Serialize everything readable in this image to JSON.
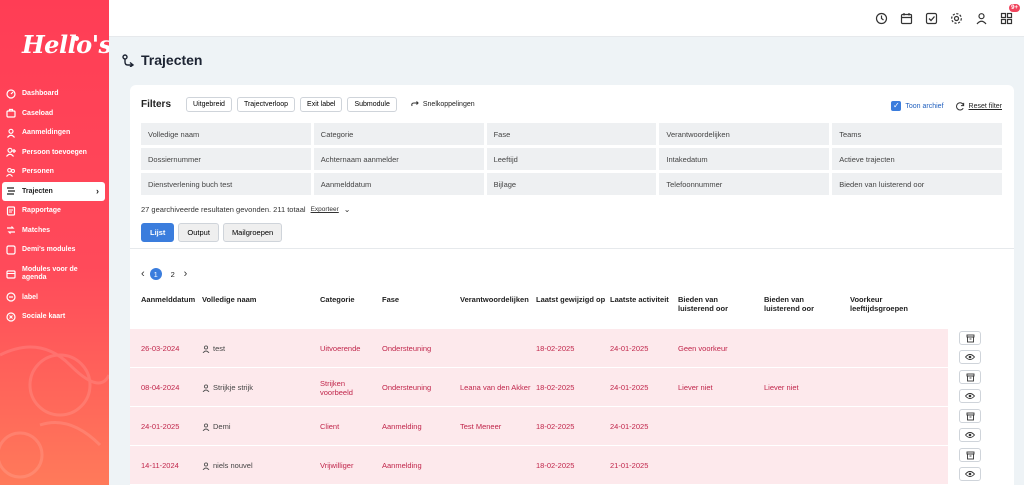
{
  "brand": {
    "logo": "Hello's",
    "accent": "#ff4a5a",
    "primary": "#3b7ddd",
    "row_tint": "#fde9ec"
  },
  "sidebar": {
    "items": [
      {
        "label": "Dashboard",
        "icon": "dashboard-icon"
      },
      {
        "label": "Caseload",
        "icon": "briefcase-icon"
      },
      {
        "label": "Aanmeldingen",
        "icon": "user-icon"
      },
      {
        "label": "Persoon toevoegen",
        "icon": "user-plus-icon"
      },
      {
        "label": "Personen",
        "icon": "users-icon"
      },
      {
        "label": "Trajecten",
        "icon": "route-icon",
        "active": true
      },
      {
        "label": "Rapportage",
        "icon": "report-icon"
      },
      {
        "label": "Matches",
        "icon": "match-icon"
      },
      {
        "label": "Demi's modules",
        "icon": "module-icon"
      },
      {
        "label": "Modules voor de agenda",
        "icon": "calendar-module-icon"
      },
      {
        "label": "label",
        "icon": "label-icon"
      },
      {
        "label": "Sociale kaart",
        "icon": "map-icon"
      }
    ]
  },
  "topbar": {
    "notification_badge": "9+"
  },
  "page": {
    "title": "Trajecten"
  },
  "filters": {
    "title": "Filters",
    "chips": [
      "Uitgebreid",
      "Trajectverloop",
      "Exit label",
      "Submodule"
    ],
    "shortcuts_label": "Snelkoppelingen",
    "show_archive_label": "Toon archief",
    "reset_label": "Reset filter",
    "fields": [
      "Volledige naam",
      "Categorie",
      "Fase",
      "Verantwoordelijken",
      "Teams",
      "Dossiernummer",
      "Achternaam aanmelder",
      "Leeftijd",
      "Intakedatum",
      "Actieve trajecten",
      "Dienstverlening buch test",
      "Aanmelddatum",
      "Bijlage",
      "Telefoonnummer",
      "Bieden van luisterend oor"
    ]
  },
  "results": {
    "summary": "27 gearchiveerde resultaten gevonden. 211 totaal",
    "export_label": "Exporteer"
  },
  "view_tabs": [
    "Lijst",
    "Output",
    "Mailgroepen"
  ],
  "pagination": {
    "pages": [
      "1",
      "2"
    ],
    "current": "1"
  },
  "table": {
    "columns": [
      "Aanmelddatum",
      "Volledige naam",
      "Categorie",
      "Fase",
      "Verantwoordelijken",
      "Laatst gewijzigd op",
      "Laatste activiteit",
      "Bieden van luisterend oor",
      "Bieden van luisterend oor",
      "Voorkeur leeftijdsgroepen"
    ],
    "rows": [
      {
        "date": "26-03-2024",
        "name": "test",
        "category": "Uitvoerende",
        "phase": "Ondersteuning",
        "owner": "",
        "modified": "18-02-2025",
        "activity": "24-01-2025",
        "listen1": "Geen voorkeur",
        "listen2": "",
        "age": ""
      },
      {
        "date": "08-04-2024",
        "name": "Strijkje strijk",
        "category": "Strijken voorbeeld",
        "phase": "Ondersteuning",
        "owner": "Leana van den Akker",
        "modified": "18-02-2025",
        "activity": "24-01-2025",
        "listen1": "Liever niet",
        "listen2": "Liever niet",
        "age": ""
      },
      {
        "date": "24-01-2025",
        "name": "Demi",
        "category": "Client",
        "phase": "Aanmelding",
        "owner": "Test Meneer",
        "modified": "18-02-2025",
        "activity": "24-01-2025",
        "listen1": "",
        "listen2": "",
        "age": ""
      },
      {
        "date": "14-11-2024",
        "name": "niels nouvel",
        "category": "Vrijwilliger",
        "phase": "Aanmelding",
        "owner": "",
        "modified": "18-02-2025",
        "activity": "21-01-2025",
        "listen1": "",
        "listen2": "",
        "age": ""
      }
    ]
  }
}
